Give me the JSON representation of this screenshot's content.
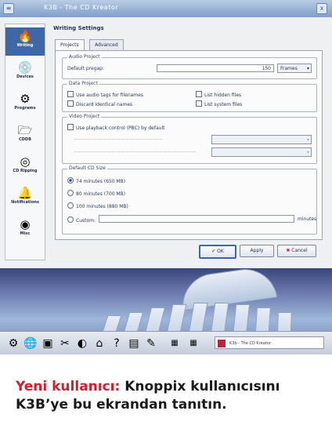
{
  "window": {
    "title": "K3B - The CD Kreator",
    "close_glyph": "x",
    "menu_glyph": "≡"
  },
  "sidebar": {
    "items": [
      {
        "label": "Writing",
        "icon": "burner-icon",
        "glyph": "🔥"
      },
      {
        "label": "Devices",
        "icon": "devices-icon",
        "glyph": "💿"
      },
      {
        "label": "Programs",
        "icon": "programs-icon",
        "glyph": "⚙"
      },
      {
        "label": "CDDB",
        "icon": "cddb-icon",
        "glyph": "🗁"
      },
      {
        "label": "CD Ripping",
        "icon": "ripping-icon",
        "glyph": "◎"
      },
      {
        "label": "Notifications",
        "icon": "notifications-icon",
        "glyph": "🔔"
      },
      {
        "label": "Misc",
        "icon": "misc-icon",
        "glyph": "◉"
      }
    ]
  },
  "page": {
    "heading": "Writing Settings",
    "tabs": [
      "Projects",
      "Advanced"
    ]
  },
  "audio_project": {
    "label": "Audio Project",
    "default_pregap_label": "Default pregap:",
    "default_pregap_value": "150",
    "unit": "Frames"
  },
  "data_project": {
    "label": "Data Project",
    "options": [
      "Use audio tags for filenames",
      "Discard identical names",
      "List hidden files",
      "List system files"
    ]
  },
  "video_project": {
    "label": "Video Project",
    "option": "Use playback control (PBC) by default"
  },
  "default_cd_size": {
    "label": "Default CD Size",
    "options": [
      "74 minutes (650 MB)",
      "80 minutes (700 MB)",
      "100 minutes (880 MB)",
      "Custom:"
    ],
    "selected": 0,
    "custom_unit": "minutes"
  },
  "buttons": {
    "ok": "OK",
    "apply": "Apply",
    "cancel": "Cancel"
  },
  "taskbar": {
    "task_label": "K3b - The CD Kreator",
    "icons": [
      "kde-menu-icon",
      "web-icon",
      "terminal-icon",
      "tools-icon",
      "konqueror-icon",
      "home-icon",
      "help-icon",
      "office-icon",
      "chart-icon"
    ]
  },
  "caption": {
    "lead": "Yeni kullanıcı:",
    "text": " Knoppix kullanıcısını K3B’ye bu ekrandan tanıtın."
  }
}
